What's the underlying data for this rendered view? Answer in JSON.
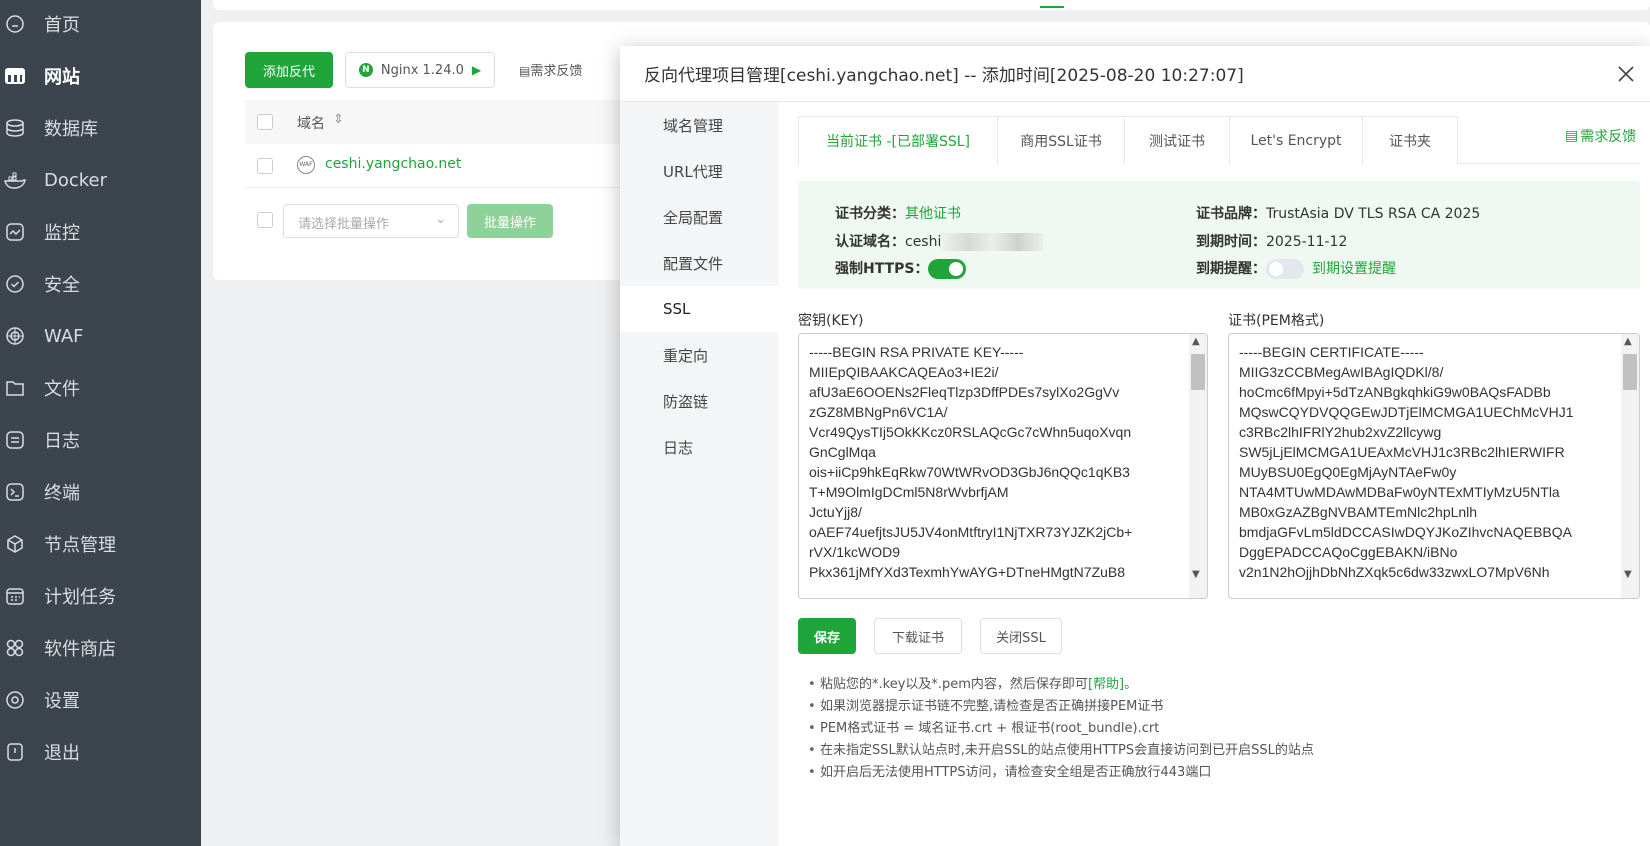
{
  "sidebar": {
    "items": [
      {
        "label": "首页",
        "icon": "home-icon"
      },
      {
        "label": "网站",
        "icon": "website-icon",
        "active": true
      },
      {
        "label": "数据库",
        "icon": "database-icon"
      },
      {
        "label": "Docker",
        "icon": "docker-icon"
      },
      {
        "label": "监控",
        "icon": "monitor-icon"
      },
      {
        "label": "安全",
        "icon": "shield-icon"
      },
      {
        "label": "WAF",
        "icon": "waf-icon"
      },
      {
        "label": "文件",
        "icon": "folder-icon"
      },
      {
        "label": "日志",
        "icon": "log-icon"
      },
      {
        "label": "终端",
        "icon": "terminal-icon"
      },
      {
        "label": "节点管理",
        "icon": "node-icon"
      },
      {
        "label": "计划任务",
        "icon": "calendar-icon"
      },
      {
        "label": "软件商店",
        "icon": "store-icon"
      },
      {
        "label": "设置",
        "icon": "settings-icon"
      },
      {
        "label": "退出",
        "icon": "logout-icon"
      }
    ]
  },
  "site": {
    "add_proxy": "添加反代",
    "nginx": "Nginx 1.24.0",
    "feedback": "需求反馈",
    "col_domain": "域名",
    "row_domain": "ceshi.yangchao.net",
    "batch_placeholder": "请选择批量操作",
    "batch_button": "批量操作"
  },
  "modal": {
    "title": "反向代理项目管理[ceshi.yangchao.net] -- 添加时间[2025-08-20 10:27:07]",
    "nav": [
      "域名管理",
      "URL代理",
      "全局配置",
      "配置文件",
      "SSL",
      "重定向",
      "防盗链",
      "日志"
    ],
    "nav_active": "SSL",
    "tabs": [
      "当前证书 -[已部署SSL]",
      "商用SSL证书",
      "测试证书",
      "Let's Encrypt",
      "证书夹"
    ],
    "feedback": "需求反馈",
    "info": {
      "category_label": "证书分类：",
      "category_value": "其他证书",
      "domain_label": "认证域名：",
      "domain_value": "ceshi",
      "https_label": "强制HTTPS：",
      "brand_label": "证书品牌：",
      "brand_value": "TrustAsia DV TLS RSA CA 2025",
      "expire_label": "到期时间：",
      "expire_value": "2025-11-12",
      "remind_label": "到期提醒：",
      "remind_link": "到期设置提醒",
      "force_https": true,
      "remind_on": false
    },
    "key_label": "密钥(KEY)",
    "cert_label": "证书(PEM格式)",
    "key_text": "-----BEGIN RSA PRIVATE KEY-----\nMIIEpQIBAAKCAQEAo3+IE2i/\nafU3aE6OOENs2FleqTlzp3DffPDEs7sylXo2GgVv\nzGZ8MBNgPn6VC1A/\nVcr49QysTIj5OkKKcz0RSLAQcGc7cWhn5uqoXvqn\nGnCglMqa\nois+iiCp9hkEqRkw70WtWRvOD3GbJ6nQQc1qKB3\nT+M9OlmIgDCml5N8rWvbrfjAM\nJctuYjj8/\noAEF74uefjtsJU5JV4onMtftryI1NjTXR73YJZK2jCb+\nrVX/1kcWOD9\nPkx361jMfYXd3TexmhYwAYG+DTneHMgtN7ZuB8",
    "cert_text": "-----BEGIN CERTIFICATE-----\nMIIG3zCCBMegAwIBAgIQDKl/8/\nhoCmc6fMpyi+5dTzANBgkqhkiG9w0BAQsFADBb\nMQswCQYDVQQGEwJDTjElMCMGA1UEChMcVHJ1\nc3RBc2lhIFRlY2hub2xvZ2llcywg\nSW5jLjElMCMGA1UEAxMcVHJ1c3RBc2lhIERWIFR\nMUyBSU0EgQ0EgMjAyNTAeFw0y\nNTA4MTUwMDAwMDBaFw0yNTExMTIyMzU5NTla\nMB0xGzAZBgNVBAMTEmNlc2hpLnlh\nbmdjaGFvLm5ldDCCASIwDQYJKoZIhvcNAQEBBQA\nDggEPADCCAQoCggEBAKN/iBNo\nv2n1N2hOjjhDbNhZXqk5c6dw33zwxLO7MpV6Nh",
    "buttons": {
      "save": "保存",
      "download": "下载证书",
      "close_ssl": "关闭SSL"
    },
    "tips": [
      [
        "粘贴您的*.key以及*.pem内容，然后保存即可",
        "[帮助]",
        "。"
      ],
      "如果浏览器提示证书链不完整,请检查是否正确拼接PEM证书",
      "PEM格式证书 = 域名证书.crt + 根证书(root_bundle).crt",
      "在未指定SSL默认站点时,未开启SSL的站点使用HTTPS会直接访问到已开启SSL的站点",
      "如开启后无法使用HTTPS访问，请检查安全组是否正确放行443端口"
    ]
  },
  "colors": {
    "accent": "#20a53a",
    "sidebar": "#3c444d"
  }
}
